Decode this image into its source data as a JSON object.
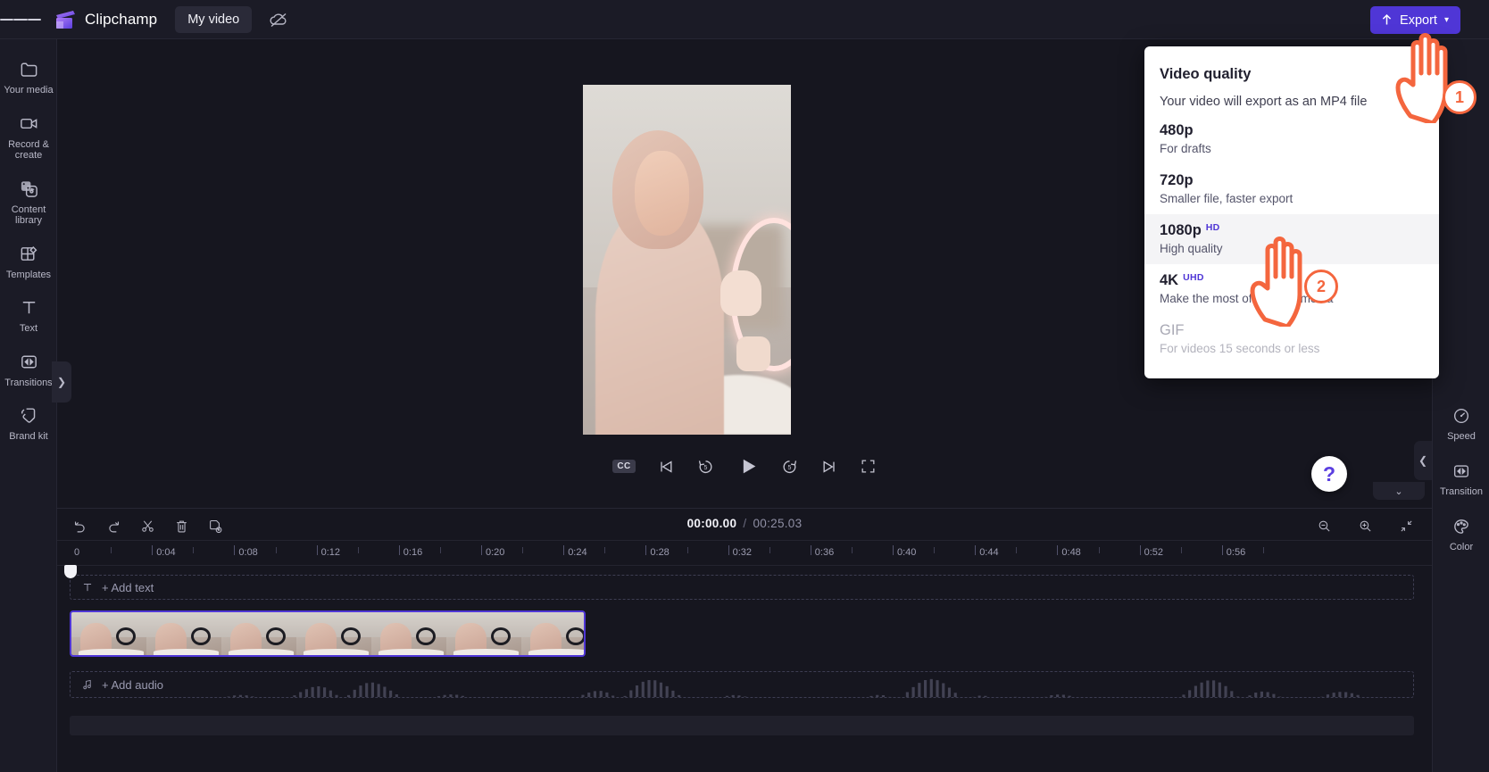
{
  "app": {
    "brand_name": "Clipchamp",
    "project_title": "My video"
  },
  "topbar": {
    "menu_icon": "hamburger-icon",
    "logo_icon": "clipchamp-logo-icon",
    "cloud_icon": "cloud-off-icon",
    "export_label": "Export",
    "export_icon": "upload-arrow-icon",
    "export_chevron": "chevron-down-icon",
    "accent_color": "#4f36d6"
  },
  "sidebar": {
    "items": [
      {
        "label": "Your media",
        "icon": "folder-icon"
      },
      {
        "label": "Record & create",
        "icon": "video-camera-icon"
      },
      {
        "label": "Content library",
        "icon": "dice-icon"
      },
      {
        "label": "Templates",
        "icon": "templates-grid-icon"
      },
      {
        "label": "Text",
        "icon": "text-t-icon"
      },
      {
        "label": "Transitions",
        "icon": "transition-icon"
      },
      {
        "label": "Brand kit",
        "icon": "tag-icon"
      }
    ],
    "expand_icon": "chevron-right-icon"
  },
  "export_menu": {
    "title": "Video quality",
    "subtitle": "Your video will export as an MP4 file",
    "options": [
      {
        "name": "480p",
        "badge": "",
        "desc": "For drafts",
        "state": "normal"
      },
      {
        "name": "720p",
        "badge": "",
        "desc": "Smaller file, faster export",
        "state": "normal"
      },
      {
        "name": "1080p",
        "badge": "HD",
        "desc": "High quality",
        "state": "active"
      },
      {
        "name": "4K",
        "badge": "UHD",
        "desc": "Make the most of your 4K media",
        "state": "normal"
      },
      {
        "name": "GIF",
        "badge": "",
        "desc": "For videos 15 seconds or less",
        "state": "disabled"
      }
    ],
    "badge_color": "#4f36d6"
  },
  "player": {
    "controls": [
      {
        "icon": "closed-captions-icon",
        "label": "CC"
      },
      {
        "icon": "skip-previous-icon",
        "label": ""
      },
      {
        "icon": "rewind-5-icon",
        "label": "5"
      },
      {
        "icon": "play-icon",
        "label": ""
      },
      {
        "icon": "forward-5-icon",
        "label": "5"
      },
      {
        "icon": "skip-next-icon",
        "label": ""
      },
      {
        "icon": "fullscreen-icon",
        "label": ""
      }
    ],
    "help_icon": "question-mark-icon",
    "collapse_icon": "chevron-left-icon",
    "panel_chevron_icon": "chevron-down-icon"
  },
  "properties_rail": {
    "items": [
      {
        "label": "Speed",
        "icon": "speedometer-icon"
      },
      {
        "label": "Transition",
        "icon": "transition-icon"
      },
      {
        "label": "Color",
        "icon": "color-palette-icon"
      }
    ]
  },
  "timeline": {
    "tools": [
      {
        "name": "undo",
        "icon": "undo-arrow-icon"
      },
      {
        "name": "redo",
        "icon": "redo-arrow-icon"
      },
      {
        "name": "split",
        "icon": "scissors-icon"
      },
      {
        "name": "delete",
        "icon": "trash-icon"
      },
      {
        "name": "duplicate",
        "icon": "duplicate-icon"
      }
    ],
    "current_time": "00:00.00",
    "separator": "/",
    "total_time": "00:25.03",
    "zoom_controls": [
      {
        "name": "zoom-out",
        "icon": "magnifier-minus-icon"
      },
      {
        "name": "zoom-in",
        "icon": "magnifier-plus-icon"
      },
      {
        "name": "fit-to-screen",
        "icon": "fit-screen-icon"
      }
    ],
    "ruler_labels": [
      "0",
      "0:04",
      "0:08",
      "0:12",
      "0:16",
      "0:20",
      "0:24",
      "0:28",
      "0:32",
      "0:36",
      "0:40",
      "0:44",
      "0:48",
      "0:52",
      "0:56"
    ],
    "add_text_label": "+ Add text",
    "add_text_icon": "text-t-icon",
    "add_audio_label": "+ Add audio",
    "add_audio_icon": "music-note-icon",
    "clip_selected_color": "#4f36d6"
  },
  "annotations": [
    {
      "number": "1",
      "target": "export-button",
      "color": "#f4663e"
    },
    {
      "number": "2",
      "target": "export-option-1080p",
      "color": "#f4663e"
    }
  ]
}
